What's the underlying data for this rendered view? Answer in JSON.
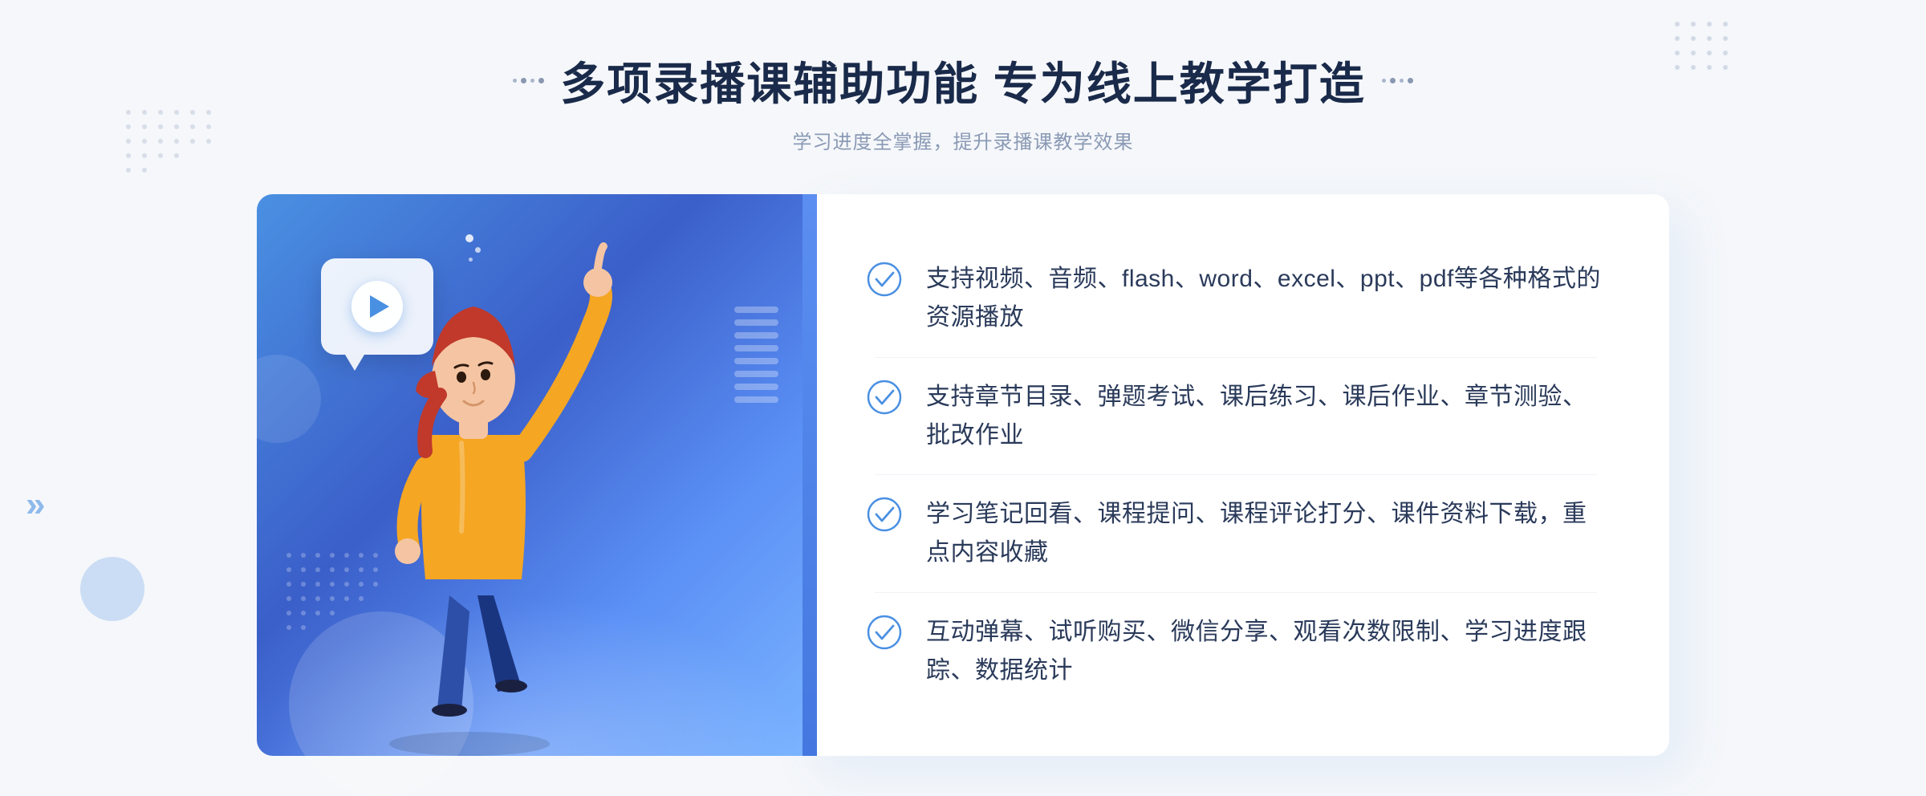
{
  "header": {
    "title": "多项录播课辅助功能 专为线上教学打造",
    "subtitle": "学习进度全掌握，提升录播课教学效果",
    "decorator_left": "⠿",
    "decorator_right": "⠿"
  },
  "features": [
    {
      "id": 1,
      "text": "支持视频、音频、flash、word、excel、ppt、pdf等各种格式的资源播放"
    },
    {
      "id": 2,
      "text": "支持章节目录、弹题考试、课后练习、课后作业、章节测验、批改作业"
    },
    {
      "id": 3,
      "text": "学习笔记回看、课程提问、课程评论打分、课件资料下载，重点内容收藏"
    },
    {
      "id": 4,
      "text": "互动弹幕、试听购买、微信分享、观看次数限制、学习进度跟踪、数据统计"
    }
  ],
  "colors": {
    "primary_blue": "#4a90e2",
    "dark_blue": "#1a2a4a",
    "text_color": "#2a3a5a",
    "subtitle_color": "#8a9ab5",
    "bg_color": "#f5f7fa",
    "check_color": "#4a90e2"
  },
  "decorations": {
    "left_chevron": "»",
    "play_icon": "▶"
  }
}
